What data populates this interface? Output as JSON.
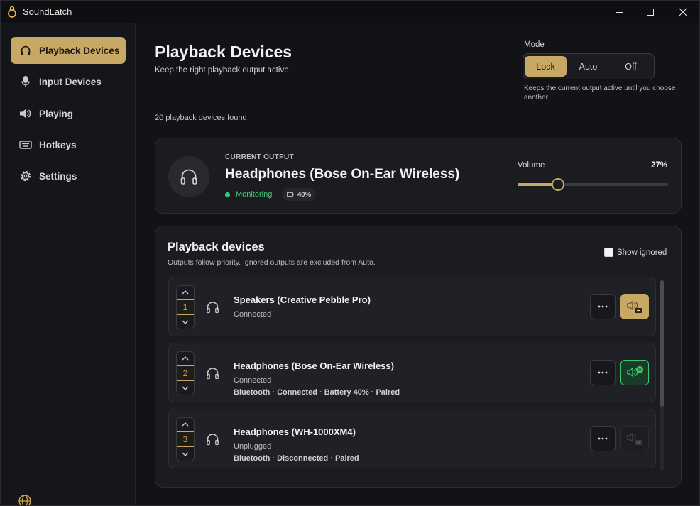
{
  "app": {
    "title": "SoundLatch"
  },
  "sidebar": {
    "items": [
      {
        "label": "Playback Devices",
        "icon": "headphones-icon",
        "active": true
      },
      {
        "label": "Input Devices",
        "icon": "microphone-icon"
      },
      {
        "label": "Playing",
        "icon": "speaker-icon"
      },
      {
        "label": "Hotkeys",
        "icon": "keyboard-icon"
      },
      {
        "label": "Settings",
        "icon": "gear-icon"
      }
    ],
    "footer_icon": "globe-icon"
  },
  "header": {
    "title": "Playback Devices",
    "subtitle": "Keep the right playback output active",
    "found_count": "20 playback devices found"
  },
  "mode": {
    "label": "Mode",
    "options": [
      "Lock",
      "Auto",
      "Off"
    ],
    "selected": "Lock",
    "description": "Keeps the current output active until you choose another."
  },
  "current_output": {
    "label": "CURRENT OUTPUT",
    "name": "Headphones (Bose On-Ear Wireless)",
    "status": "Monitoring",
    "battery": "40%",
    "volume_label": "Volume",
    "volume_text": "27%",
    "volume_value": 27
  },
  "devices": {
    "title": "Playback devices",
    "subtitle": "Outputs follow priority. Ignored outputs are excluded from Auto.",
    "show_ignored_label": "Show ignored",
    "items": [
      {
        "priority": "1",
        "name": "Speakers (Creative Pebble Pro)",
        "state": "Connected",
        "meta": "",
        "action_state": "gold"
      },
      {
        "priority": "2",
        "name": "Headphones (Bose On-Ear Wireless)",
        "state": "Connected",
        "meta": "Bluetooth  ·  Connected  ·  Battery 40%  ·  Paired",
        "action_state": "green"
      },
      {
        "priority": "3",
        "name": "Headphones (WH-1000XM4)",
        "state": "Unplugged",
        "meta": "Bluetooth  ·  Disconnected  ·  Paired",
        "action_state": "dim"
      }
    ]
  },
  "colors": {
    "accent": "#c8a865",
    "success": "#3ec86e",
    "background": "#121316",
    "card": "#1b1c20"
  }
}
